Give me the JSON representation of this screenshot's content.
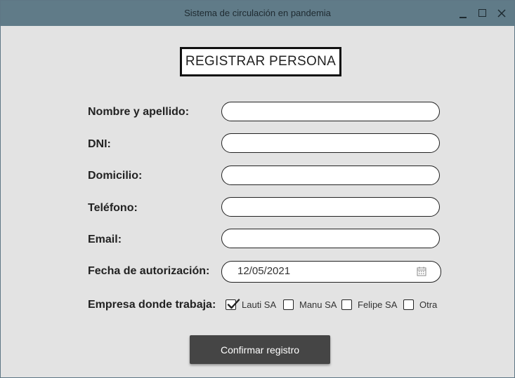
{
  "window": {
    "title": "Sistema de circulación en pandemia"
  },
  "form": {
    "heading": "REGISTRAR PERSONA",
    "fields": {
      "nombre": {
        "label": "Nombre y apellido:",
        "value": ""
      },
      "dni": {
        "label": "DNI:",
        "value": ""
      },
      "domicilio": {
        "label": "Domicilio:",
        "value": ""
      },
      "telefono": {
        "label": "Teléfono:",
        "value": ""
      },
      "email": {
        "label": "Email:",
        "value": ""
      },
      "fecha": {
        "label": "Fecha de autorización:",
        "value": "12/05/2021",
        "icon": "calendar-icon"
      }
    },
    "empresa": {
      "label": "Empresa donde trabaja:",
      "options": [
        {
          "label": "Lauti SA",
          "checked": true
        },
        {
          "label": "Manu SA",
          "checked": false
        },
        {
          "label": "Felipe SA",
          "checked": false
        },
        {
          "label": "Otra",
          "checked": false
        }
      ]
    },
    "confirm_label": "Confirmar registro"
  }
}
